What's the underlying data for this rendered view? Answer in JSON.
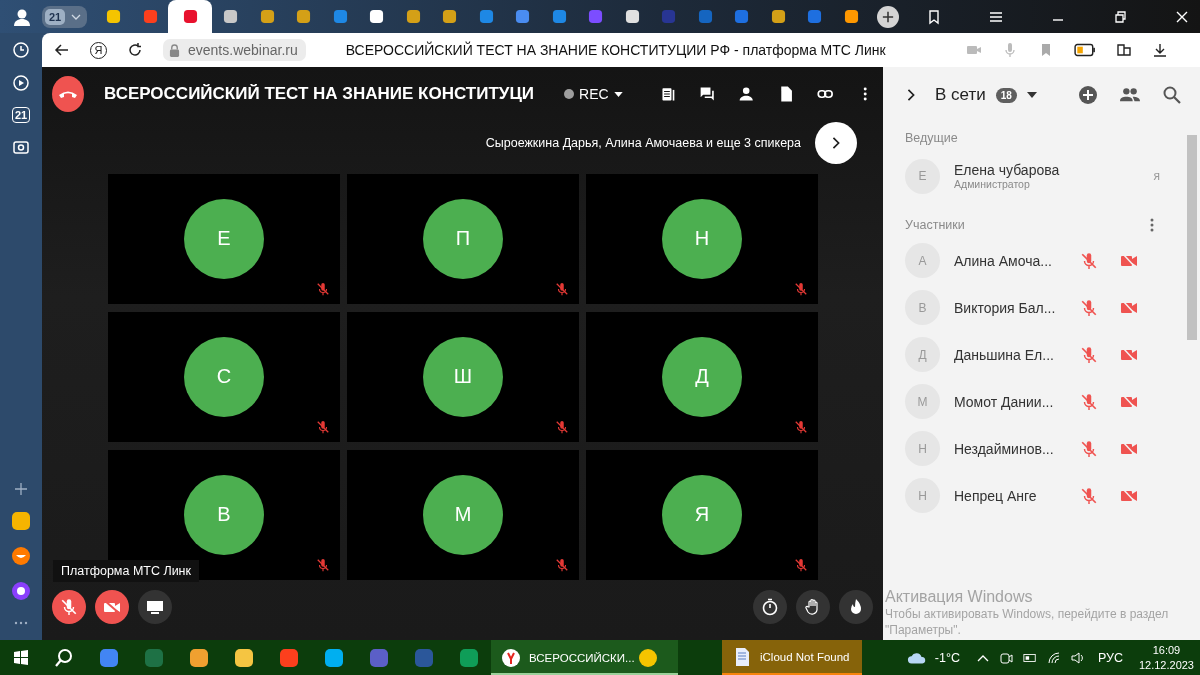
{
  "browser": {
    "group": "21",
    "tabs": [
      {
        "color": "#f5c400",
        "selected": false
      },
      {
        "color": "#fc3f1d",
        "selected": false
      },
      {
        "color": "#e8112d",
        "selected": true
      },
      {
        "color": "#c8c8c8",
        "selected": false
      },
      {
        "color": "#d4a017",
        "selected": false
      },
      {
        "color": "#d4a017",
        "selected": false
      },
      {
        "color": "#1e88e5",
        "selected": false
      },
      {
        "color": "#ffffff",
        "selected": false
      },
      {
        "color": "#d4a017",
        "selected": false
      },
      {
        "color": "#d4a017",
        "selected": false
      },
      {
        "color": "#1e88e5",
        "selected": false
      },
      {
        "color": "#4a8cf0",
        "selected": false
      },
      {
        "color": "#1e88e5",
        "selected": false
      },
      {
        "color": "#7c4dff",
        "selected": false
      },
      {
        "color": "#e0e0e0",
        "selected": false
      },
      {
        "color": "#283593",
        "selected": false
      },
      {
        "color": "#1565c0",
        "selected": false
      },
      {
        "color": "#1e6fe0",
        "selected": false
      },
      {
        "color": "#d4a017",
        "selected": false
      },
      {
        "color": "#1e6fe0",
        "selected": false
      },
      {
        "color": "#ff9800",
        "selected": false
      }
    ],
    "yandex_glyph": "Я",
    "url": "events.webinar.ru",
    "page_title": "ВСЕРОССИЙСКИЙ ТЕСТ НА ЗНАНИЕ КОНСТИТУЦИИ РФ - платформа МТС Линк"
  },
  "side_panel": {
    "badge": "21"
  },
  "meeting": {
    "title": "ВСЕРОССИЙСКИЙ ТЕСТ НА ЗНАНИЕ КОНСТИТУЦИ",
    "rec": "REC",
    "speakers": "Сыроежкина Дарья, Алина Амочаева и еще 3 спикера",
    "tiles": [
      {
        "initial": "Е",
        "mic_muted": true
      },
      {
        "initial": "П",
        "mic_muted": true
      },
      {
        "initial": "Н",
        "mic_muted": true
      },
      {
        "initial": "С",
        "mic_muted": true
      },
      {
        "initial": "Ш",
        "mic_muted": true
      },
      {
        "initial": "Д",
        "mic_muted": true
      },
      {
        "initial": "В",
        "mic_muted": true
      },
      {
        "initial": "М",
        "mic_muted": true
      },
      {
        "initial": "Я",
        "mic_muted": true
      }
    ],
    "toast": "Платформа МТС Линк",
    "mic_muted": true,
    "cam_muted": true
  },
  "panel": {
    "title": "В сети",
    "count": "18",
    "hosts_heading": "Ведущие",
    "host": {
      "initial": "Е",
      "name": "Елена чубарова",
      "role": "Администратор",
      "tag": "я"
    },
    "participants_heading": "Участники",
    "participants": [
      {
        "initial": "А",
        "name": "Алина Амоча...",
        "mic_muted": true,
        "cam_muted": true
      },
      {
        "initial": "В",
        "name": "Виктория Бал...",
        "mic_muted": true,
        "cam_muted": true
      },
      {
        "initial": "Д",
        "name": "Даньшина Ел...",
        "mic_muted": true,
        "cam_muted": true
      },
      {
        "initial": "М",
        "name": "Момот Дании...",
        "mic_muted": true,
        "cam_muted": true
      },
      {
        "initial": "Н",
        "name": "Нездайминов...",
        "mic_muted": true,
        "cam_muted": true
      },
      {
        "initial": "Н",
        "name": "Непрец Анге",
        "mic_muted": true,
        "cam_muted": true
      }
    ]
  },
  "activation": {
    "title": "Активация Windows",
    "text": "Чтобы активировать Windows, перейдите в раздел \"Параметры\"."
  },
  "taskbar": {
    "tasks": [
      {
        "kind": "browser",
        "label": "ВСЕРОССИЙСКИ...",
        "selected": true,
        "attention": false
      },
      {
        "kind": "document",
        "label": "iCloud Not Found",
        "selected": false,
        "attention": true
      }
    ],
    "temperature": "-1°C",
    "language": "РУС",
    "time": "16:09",
    "date": "12.12.2023"
  }
}
